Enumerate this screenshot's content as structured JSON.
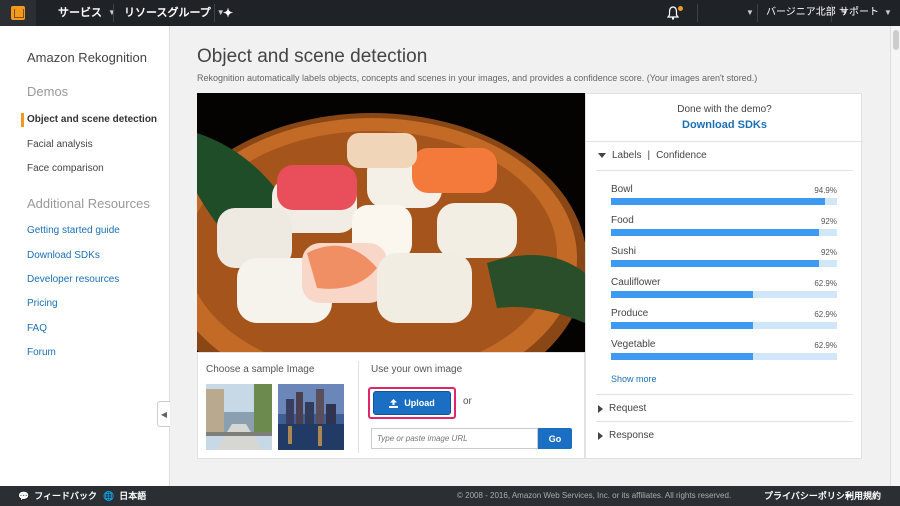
{
  "topnav": {
    "services": "サービス",
    "resource_groups": "リソースグループ",
    "region": "バージニア北部",
    "support": "サポート"
  },
  "sidebar": {
    "title": "Amazon Rekognition",
    "demos_heading": "Demos",
    "demos": [
      {
        "label": "Object and scene detection"
      },
      {
        "label": "Facial analysis"
      },
      {
        "label": "Face comparison"
      }
    ],
    "resources_heading": "Additional Resources",
    "resources": [
      {
        "label": "Getting started guide"
      },
      {
        "label": "Download SDKs"
      },
      {
        "label": "Developer resources"
      },
      {
        "label": "Pricing"
      },
      {
        "label": "FAQ"
      },
      {
        "label": "Forum"
      }
    ]
  },
  "main": {
    "title": "Object and scene detection",
    "subtitle": "Rekognition automatically labels objects, concepts and scenes in your images, and provides a confidence score. (Your images aren't stored.)",
    "sample_title": "Choose a sample Image",
    "own_title": "Use your own image",
    "upload_label": "Upload",
    "or_text": "or",
    "url_placeholder": "Type or paste image URL",
    "go_label": "Go"
  },
  "panel": {
    "done_text": "Done with the demo?",
    "download_sdks": "Download SDKs",
    "labels_header": "Labels",
    "labels_sep": "|",
    "confidence_header": "Confidence",
    "labels": [
      {
        "name": "Bowl",
        "value": "94.9%",
        "fraction": 0.949
      },
      {
        "name": "Food",
        "value": "92%",
        "fraction": 0.92
      },
      {
        "name": "Sushi",
        "value": "92%",
        "fraction": 0.92
      },
      {
        "name": "Cauliflower",
        "value": "62.9%",
        "fraction": 0.629
      },
      {
        "name": "Produce",
        "value": "62.9%",
        "fraction": 0.629
      },
      {
        "name": "Vegetable",
        "value": "62.9%",
        "fraction": 0.629
      }
    ],
    "show_more": "Show more",
    "request": "Request",
    "response": "Response"
  },
  "footer": {
    "feedback": "フィードバック",
    "language": "日本語",
    "copyright": "© 2008 - 2016, Amazon Web Services, Inc. or its affiliates. All rights reserved.",
    "privacy": "プライバシーポリシー",
    "terms": "利用規約"
  },
  "colors": {
    "accent": "#f29a1f",
    "link": "#1a6fb5",
    "bar": "#3d9af0",
    "bar_bg": "#cfe6fb",
    "highlight": "#e0256b"
  }
}
